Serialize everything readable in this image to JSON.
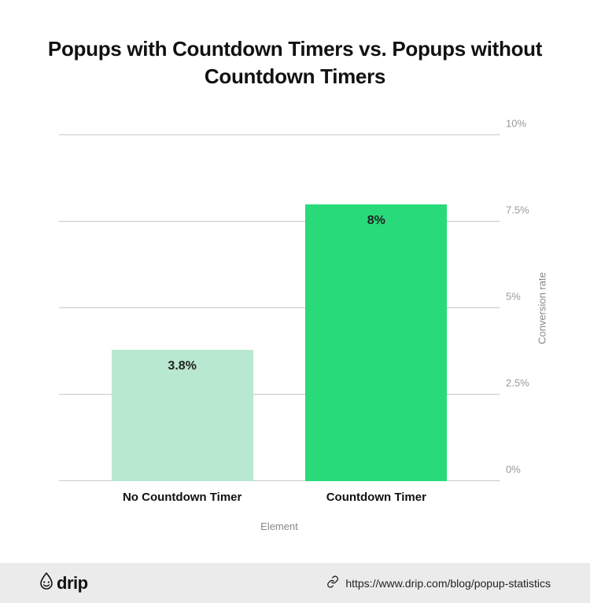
{
  "title": "Popups with Countdown Timers vs. Popups without Countdown Timers",
  "xlabel": "Element",
  "ylabel": "Conversion rate",
  "y_ticks": [
    "0%",
    "2.5%",
    "5%",
    "7.5%",
    "10%"
  ],
  "bars": [
    {
      "category": "No Countdown Timer",
      "value_label": "3.8%"
    },
    {
      "category": "Countdown Timer",
      "value_label": "8%"
    }
  ],
  "footer": {
    "logo_text": "drip",
    "source_url": "https://www.drip.com/blog/popup-statistics"
  },
  "chart_data": {
    "type": "bar",
    "title": "Popups with Countdown Timers vs. Popups without Countdown Timers",
    "xlabel": "Element",
    "ylabel": "Conversion rate",
    "ylim": [
      0,
      10
    ],
    "categories": [
      "No Countdown Timer",
      "Countdown Timer"
    ],
    "values": [
      3.8,
      8
    ],
    "y_ticks": [
      0,
      2.5,
      5,
      7.5,
      10
    ]
  }
}
